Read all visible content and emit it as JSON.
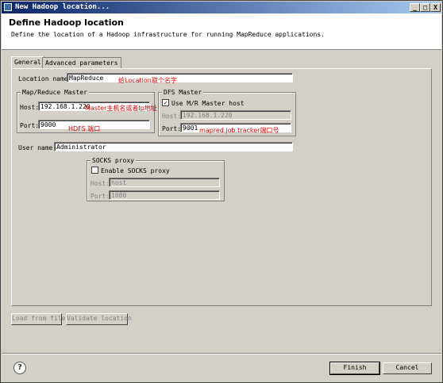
{
  "window": {
    "title": "New Hadoop location...",
    "minimize": "_",
    "maximize": "□",
    "close": "X"
  },
  "header": {
    "title": "Define Hadoop location",
    "description": "Define the location of a Hadoop infrastructure for running MapReduce applications."
  },
  "tabs": [
    {
      "label": "General",
      "active": true
    },
    {
      "label": "Advanced parameters",
      "active": false
    }
  ],
  "general": {
    "location_name_label": "Location name:",
    "location_name_value": "MapReduce",
    "location_name_note": "给Location取个名字",
    "mr_master": {
      "title": "Map/Reduce Master",
      "host_label": "Host:",
      "host_value": "192.168.1.220",
      "host_note": "Master主机名或者Ip地址",
      "port_label": "Port:",
      "port_value": "9000",
      "port_note": "HDFS 端口"
    },
    "dfs_master": {
      "title": "DFS Master",
      "use_mr_label": "Use M/R Master host",
      "use_mr_checked": true,
      "host_label": "Host:",
      "host_value": "192.168.1.220",
      "port_label": "Port:",
      "port_value": "9001",
      "port_note": "mapred.job.tracker端口号"
    },
    "user_name_label": "User name:",
    "user_name_value": "Administrator",
    "socks": {
      "title": "SOCKS proxy",
      "enable_label": "Enable SOCKS proxy",
      "enable_checked": false,
      "host_label": "Host:",
      "host_value": "host",
      "port_label": "Port:",
      "port_value": "1080"
    }
  },
  "buttons": {
    "load_from_file": "Load from file",
    "validate_location": "Validate location",
    "finish": "Finish",
    "cancel": "Cancel"
  },
  "help_icon": "?"
}
